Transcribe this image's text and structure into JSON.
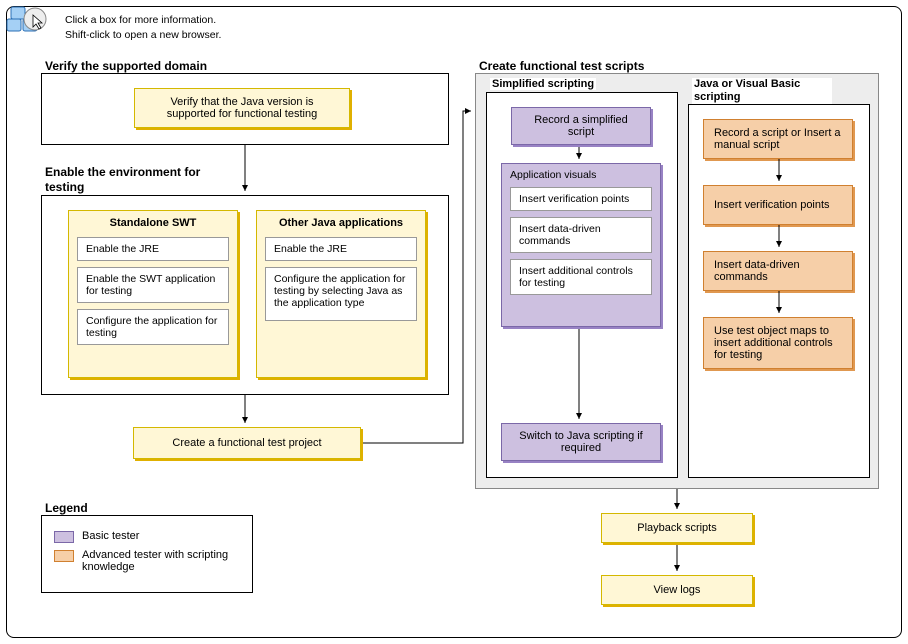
{
  "help": {
    "line1": "Click a box for more information.",
    "line2": "Shift-click to open a new browser."
  },
  "sections": {
    "verify": {
      "title": "Verify the supported domain",
      "box": "Verify that the Java version is supported for functional testing"
    },
    "enable": {
      "title": "Enable the environment for testing",
      "swt": {
        "title": "Standalone SWT",
        "items": [
          "Enable the JRE",
          "Enable the SWT application for testing",
          "Configure the application for testing"
        ]
      },
      "other": {
        "title": "Other Java applications",
        "items": [
          "Enable the JRE",
          "Configure the application for testing by selecting Java as the application type"
        ]
      }
    },
    "create_project": "Create a functional test project",
    "functional": {
      "title": "Create functional test scripts",
      "simplified": {
        "title": "Simplified scripting",
        "record": "Record a simplified script",
        "visuals": {
          "title": "Application visuals",
          "items": [
            "Insert verification points",
            "Insert data-driven commands",
            "Insert additional controls for testing"
          ]
        },
        "switch": "Switch to Java scripting if required"
      },
      "javavb": {
        "title": "Java or Visual Basic scripting",
        "items": [
          "Record a script or Insert a manual script",
          "Insert verification points",
          "Insert data-driven commands",
          "Use test object maps to insert additional controls for testing"
        ]
      }
    },
    "playback": "Playback scripts",
    "viewlogs": "View logs"
  },
  "legend": {
    "title": "Legend",
    "basic": "Basic tester",
    "advanced": "Advanced tester with scripting knowledge"
  }
}
